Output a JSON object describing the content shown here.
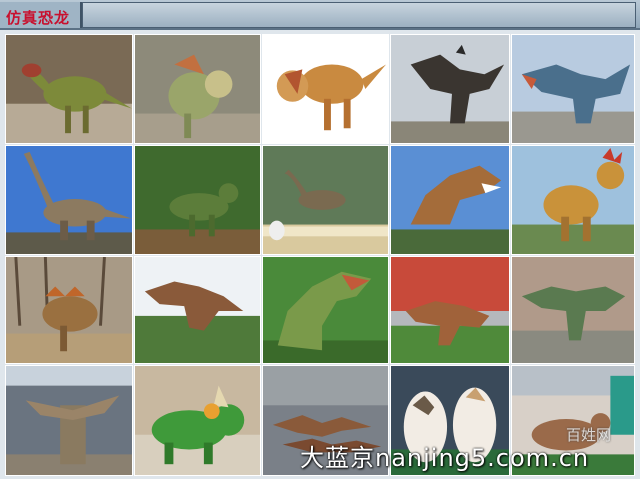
{
  "header": {
    "title": "仿真恐龙"
  },
  "watermark": {
    "text": "大蓝京nanjing5.com.cn",
    "corner_text": "百姓网"
  },
  "colors": {
    "title": "#c8102e",
    "header": "#9fb4c5"
  },
  "tiles": [
    {
      "name": "dino-photo-1"
    },
    {
      "name": "dino-photo-2"
    },
    {
      "name": "dino-photo-3"
    },
    {
      "name": "dino-photo-4"
    },
    {
      "name": "dino-photo-5"
    },
    {
      "name": "dino-photo-6"
    },
    {
      "name": "dino-photo-7"
    },
    {
      "name": "dino-photo-8"
    },
    {
      "name": "dino-photo-9"
    },
    {
      "name": "dino-photo-10"
    },
    {
      "name": "dino-photo-11"
    },
    {
      "name": "dino-photo-12"
    },
    {
      "name": "dino-photo-13"
    },
    {
      "name": "dino-photo-14"
    },
    {
      "name": "dino-photo-15"
    },
    {
      "name": "dino-photo-16"
    },
    {
      "name": "dino-photo-17"
    },
    {
      "name": "dino-photo-18"
    },
    {
      "name": "dino-photo-19"
    },
    {
      "name": "dino-photo-20"
    }
  ]
}
